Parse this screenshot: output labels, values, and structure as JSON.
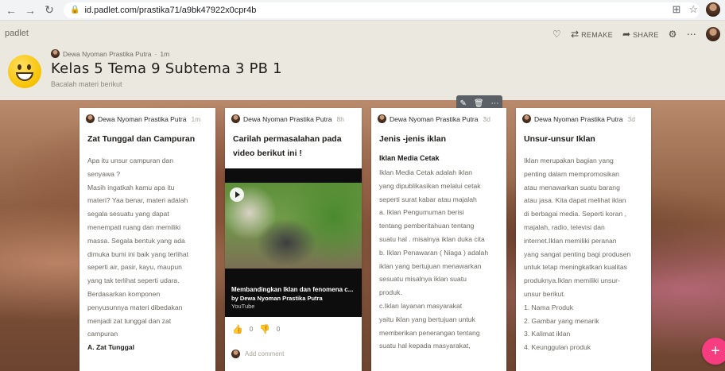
{
  "browser": {
    "url": "id.padlet.com/prastika71/a9bk47922x0cpr4b",
    "icons": [
      "back-icon",
      "forward-icon",
      "reload-icon",
      "lock-icon",
      "share-page-icon",
      "star-icon"
    ]
  },
  "padlet": {
    "logo": "padlet",
    "actions": {
      "remake": "REMAKE",
      "share": "SHARE"
    },
    "author": "Dewa Nyoman Prastika Putra",
    "age": "1m",
    "title": "Kelas 5 Tema 9 Subtema 3 PB 1",
    "subtitle": "Bacalah materi berikut"
  },
  "cards": [
    {
      "author": "Dewa Nyoman Prastika Putra",
      "age": "1m",
      "title": "Zat Tunggal dan Campuran",
      "body": [
        "Apa itu unsur campuran dan",
        "senyawa ?",
        "Masih ingatkah kamu apa itu",
        "materi? Yaa benar, materi adalah",
        "segala sesuatu yang dapat",
        "menempati ruang dan memiliki",
        "massa. Segala bentuk yang ada",
        "dimuka bumi ini baik yang terlihat",
        "seperti air, pasir, kayu, maupun",
        "yang tak terlihat seperti udara.",
        "Berdasarkan komponen",
        "penyusunnya materi dibedakan",
        "menjadi zat tunggal dan zat",
        "campuran"
      ],
      "tail": "A.  Zat Tunggal"
    },
    {
      "author": "Dewa Nyoman Prastika Putra",
      "age": "8h",
      "title_lines": [
        "Carilah permasalahan pada",
        "video berikut ini !"
      ],
      "video": {
        "title": "Membandingkan Iklan dan fenomena c...",
        "by": "by Dewa Nyoman Prastika Putra",
        "source": "YouTube"
      },
      "likes": "0",
      "dislikes": "0",
      "comment_placeholder": "Add comment"
    },
    {
      "author": "Dewa Nyoman Prastika Putra",
      "age": "3d",
      "title": "Jenis -jenis iklan",
      "subtitle": "Iklan Media Cetak",
      "body": [
        "Iklan Media Cetak adalah iklan",
        "yang dipublikasikan melalui cetak",
        "seperti surat kabar atau majalah",
        "a. Iklan Pengumuman berisi",
        "tentang pemberitahuan tentang",
        "suatu hal . misalnya iklan duka cita",
        "b. Iklan Penawaran ( Niaga ) adalah",
        "iklan yang bertujuan menawarkan",
        "sesuatu misalnya iklan suatu",
        "produk.",
        "c.Iklan layanan masyarakat",
        "yaitu iklan yang bertujuan untuk",
        "memberikan penerangan tentang",
        "suatu hal kepada masyarakat,"
      ]
    },
    {
      "author": "Dewa Nyoman Prastika Putra",
      "age": "3d",
      "title": "Unsur-unsur Iklan",
      "body": [
        "Iklan merupakan bagian yang",
        "penting dalam mempromosikan",
        "atau menawarkan suatu barang",
        "atau jasa. Kita dapat melihat iklan",
        "di berbagai media. Seperti koran ,",
        "majalah, radio, televisi dan",
        "internet.Iklan memiliki peranan",
        "yang sangat penting bagi produsen",
        "untuk tetap meningkatkan kualitas",
        "produknya.Iklan memiliki unsur-",
        "unsur berikut.",
        "1. Nama Produk",
        "2. Gambar yang menarik",
        "3. Kalimat iklan",
        "4. Keunggulan produk"
      ]
    }
  ],
  "colors": {
    "fab": "#f53d80",
    "header_bg": "#ebe8df",
    "tools_bg": "#5b6066"
  }
}
